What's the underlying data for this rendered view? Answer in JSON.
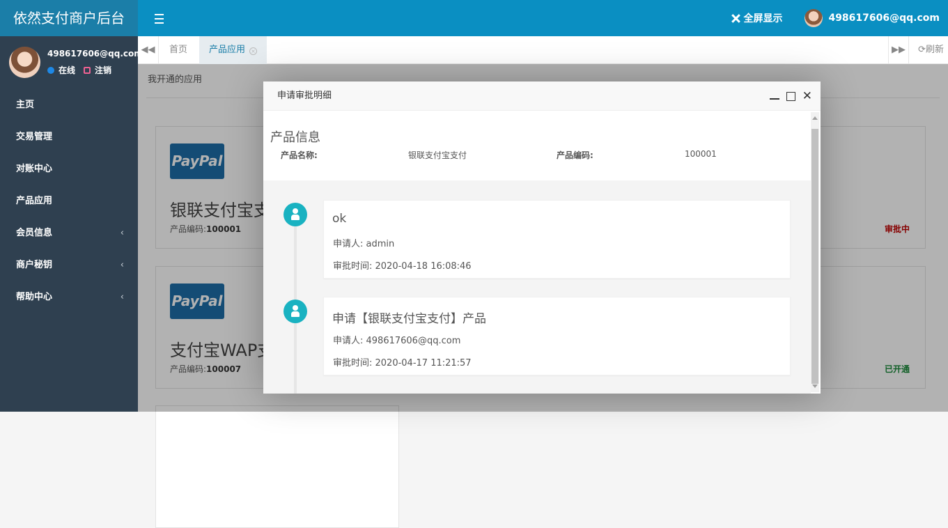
{
  "app": {
    "brand": "依然支付商户后台",
    "fullscreen_label": "全屏显示",
    "user_email": "498617606@qq.com"
  },
  "sidebar": {
    "email": "498617606@qq.com",
    "status": "在线",
    "logout": "注销",
    "items": [
      {
        "label": "主页"
      },
      {
        "label": "交易管理"
      },
      {
        "label": "对账中心"
      },
      {
        "label": "产品应用"
      },
      {
        "label": "会员信息",
        "chevron": "‹"
      },
      {
        "label": "商户秘钥",
        "chevron": "‹"
      },
      {
        "label": "帮助中心",
        "chevron": "‹"
      }
    ]
  },
  "tabs": {
    "home": "首页",
    "active": "产品应用",
    "refresh": "刷新"
  },
  "content": {
    "section_title": "我开通的应用",
    "logo_text": "PayPal",
    "code_label": "产品编码:",
    "cards": [
      {
        "name": "银联支付宝支",
        "code": "100001",
        "status": "审批中",
        "status_color": "#c00000"
      },
      {
        "name": "支付宝WAP支",
        "code": "100007",
        "status": "已开通",
        "status_color": "#1a8a3a"
      }
    ]
  },
  "modal": {
    "title": "申请审批明细",
    "info_title": "产品信息",
    "product_name_label": "产品名称:",
    "product_name": "银联支付宝支付",
    "product_code_label": "产品编码:",
    "product_code": "100001",
    "timeline": [
      {
        "heading": "ok",
        "applicant": "申请人: admin",
        "time": "审批时间: 2020-04-18 16:08:46"
      },
      {
        "heading": "申请【银联支付宝支付】产品",
        "applicant": "申请人: 498617606@qq.com",
        "time": "审批时间: 2020-04-17 11:21:57"
      }
    ]
  }
}
